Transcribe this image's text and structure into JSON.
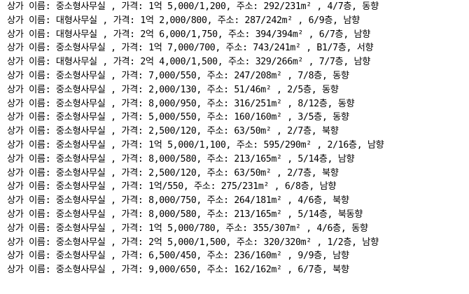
{
  "colors": {
    "background": "#ffffff",
    "text": "#000000"
  },
  "lines": [
    "상가 이름: 중소형사무실 , 가격: 1억 5,000/1,200, 주소: 292/231m² , 4/7층, 동향",
    "상가 이름: 대형사무실 , 가격: 1억 2,000/800, 주소: 287/242m² , 6/9층, 남향",
    "상가 이름: 대형사무실 , 가격: 2억 6,000/1,750, 주소: 394/394m² , 6/7층, 남향",
    "상가 이름: 중소형사무실 , 가격: 1억 7,000/700, 주소: 743/241m² , B1/7층, 서향",
    "상가 이름: 대형사무실 , 가격: 2억 4,000/1,500, 주소: 329/266m² , 7/7층, 남향",
    "상가 이름: 중소형사무실 , 가격: 7,000/550, 주소: 247/208m² , 7/8층, 동향",
    "상가 이름: 중소형사무실 , 가격: 2,000/130, 주소: 51/46m² , 2/5층, 동향",
    "상가 이름: 중소형사무실 , 가격: 8,000/950, 주소: 316/251m² , 8/12층, 동향",
    "상가 이름: 중소형사무실 , 가격: 5,000/550, 주소: 160/160m² , 3/5층, 동향",
    "상가 이름: 중소형사무실 , 가격: 2,500/120, 주소: 63/50m² , 2/7층, 북향",
    "상가 이름: 중소형사무실 , 가격: 1억 5,000/1,100, 주소: 595/290m² , 2/16층, 남향",
    "상가 이름: 중소형사무실 , 가격: 8,000/580, 주소: 213/165m² , 5/14층, 남향",
    "상가 이름: 중소형사무실 , 가격: 2,500/120, 주소: 63/50m² , 2/7층, 북향",
    "상가 이름: 중소형사무실 , 가격: 1억/550, 주소: 275/231m² , 6/8층, 남향",
    "상가 이름: 중소형사무실 , 가격: 8,000/750, 주소: 264/181m² , 4/6층, 북향",
    "상가 이름: 중소형사무실 , 가격: 8,000/580, 주소: 213/165m² , 5/14층, 북동향",
    "상가 이름: 중소형사무실 , 가격: 1억 5,000/780, 주소: 355/307m² , 4/6층, 동향",
    "상가 이름: 중소형사무실 , 가격: 2억 5,000/1,500, 주소: 320/320m² , 1/2층, 남향",
    "상가 이름: 중소형사무실 , 가격: 6,500/450, 주소: 236/160m² , 9/9층, 남향",
    "상가 이름: 중소형사무실 , 가격: 9,000/650, 주소: 162/162m² , 6/7층, 북향"
  ]
}
